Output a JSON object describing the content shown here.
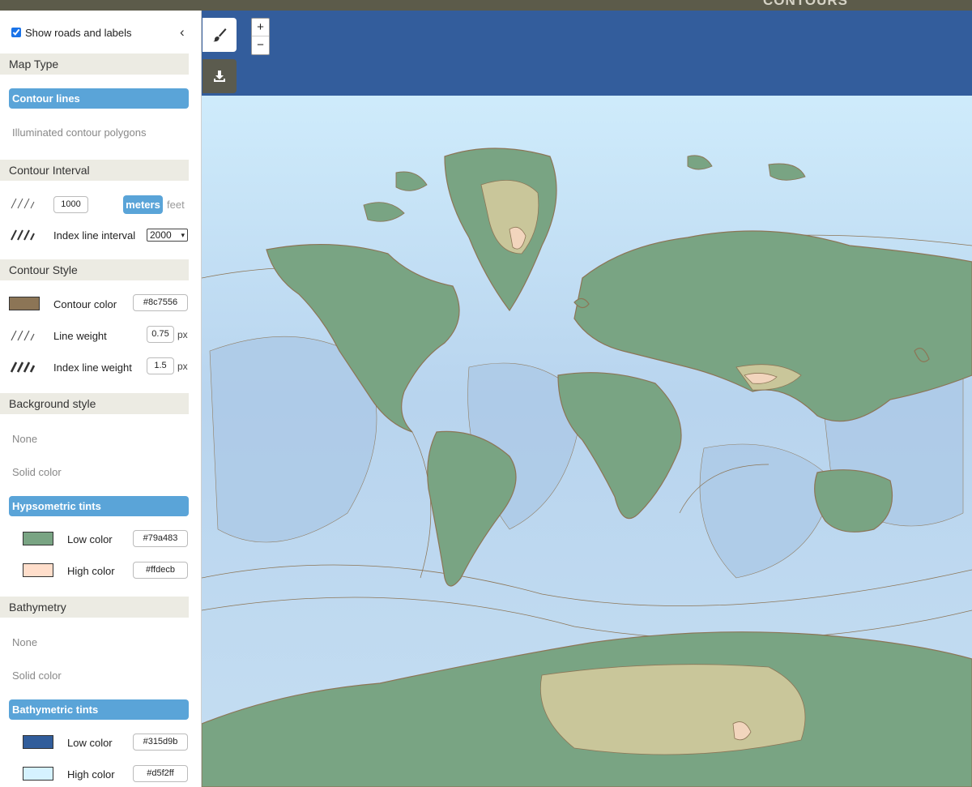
{
  "topbar": {
    "brand": "CONTOURS"
  },
  "map_controls": {
    "zoom_in": "+",
    "zoom_out": "−"
  },
  "panel": {
    "show_roads_label": "Show roads and labels",
    "show_roads_checked": true,
    "collapse": "‹",
    "map_type": {
      "title": "Map Type",
      "options": [
        "Contour lines",
        "Illuminated contour polygons"
      ],
      "selected": "Contour lines"
    },
    "contour_interval": {
      "title": "Contour Interval",
      "value": "1000",
      "unit_selected": "meters",
      "unit_other": "feet",
      "index_label": "Index line interval",
      "index_value": "2000"
    },
    "contour_style": {
      "title": "Contour Style",
      "color_label": "Contour color",
      "color_value": "#8c7556",
      "weight_label": "Line weight",
      "weight_value": "0.75",
      "weight_unit": "px",
      "index_weight_label": "Index line weight",
      "index_weight_value": "1.5",
      "index_weight_unit": "px"
    },
    "background_style": {
      "title": "Background style",
      "options": [
        "None",
        "Solid color",
        "Hypsometric tints"
      ],
      "selected": "Hypsometric tints",
      "low_label": "Low color",
      "low_value": "#79a483",
      "high_label": "High color",
      "high_value": "#ffdecb"
    },
    "bathymetry": {
      "title": "Bathymetry",
      "options": [
        "None",
        "Solid color",
        "Bathymetric tints"
      ],
      "selected": "Bathymetric tints",
      "low_label": "Low color",
      "low_value": "#315d9b",
      "high_label": "High color",
      "high_value": "#d5f2ff"
    }
  },
  "colors": {
    "contour": "#8c7556",
    "land_low": "#79a483",
    "land_high": "#ffdecb",
    "sea_deep": "#315d9b",
    "sea_shallow": "#d5f2ff",
    "accent": "#5aa4d8"
  }
}
